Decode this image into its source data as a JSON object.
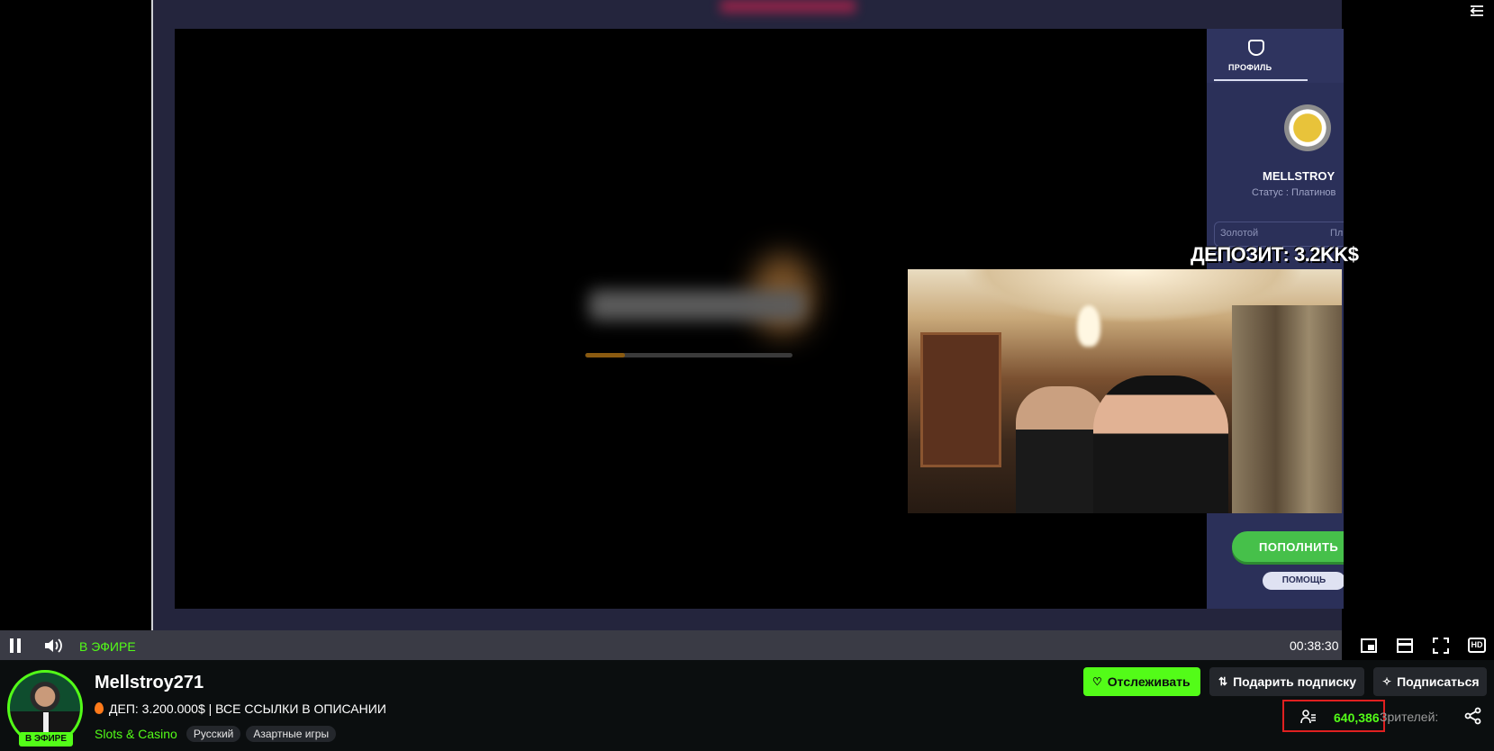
{
  "casino": {
    "profile_tab": "ПРОФИЛЬ",
    "username": "MELLSTROY",
    "status": "Статус : Платинов",
    "level_current": "Золотой",
    "level_next": "Пл",
    "topup_button": "ПОПОЛНИТЬ",
    "help_button": "ПОМОЩЬ"
  },
  "overlay": {
    "deposit": "ДЕПОЗИТ: 3.2KK$"
  },
  "player": {
    "live_label": "В ЭФИРЕ",
    "time": "00:38:30",
    "quality": "HD"
  },
  "channel": {
    "name": "Mellstroy271",
    "live_badge": "В ЭФИРЕ",
    "title": "ДЕП: 3.200.000$ | ВСЕ ССЫЛКИ В ОПИСАНИИ",
    "category": "Slots & Casino",
    "tags": [
      "Русский",
      "Азартные игры"
    ]
  },
  "actions": {
    "follow": "Отслеживать",
    "gift_sub": "Подарить подписку",
    "subscribe": "Подписаться"
  },
  "viewers": {
    "count": "640,386",
    "label": "Зрителей:"
  },
  "colors": {
    "accent": "#53fc18",
    "panel": "#2b3059",
    "highlight_box": "#e02020"
  }
}
